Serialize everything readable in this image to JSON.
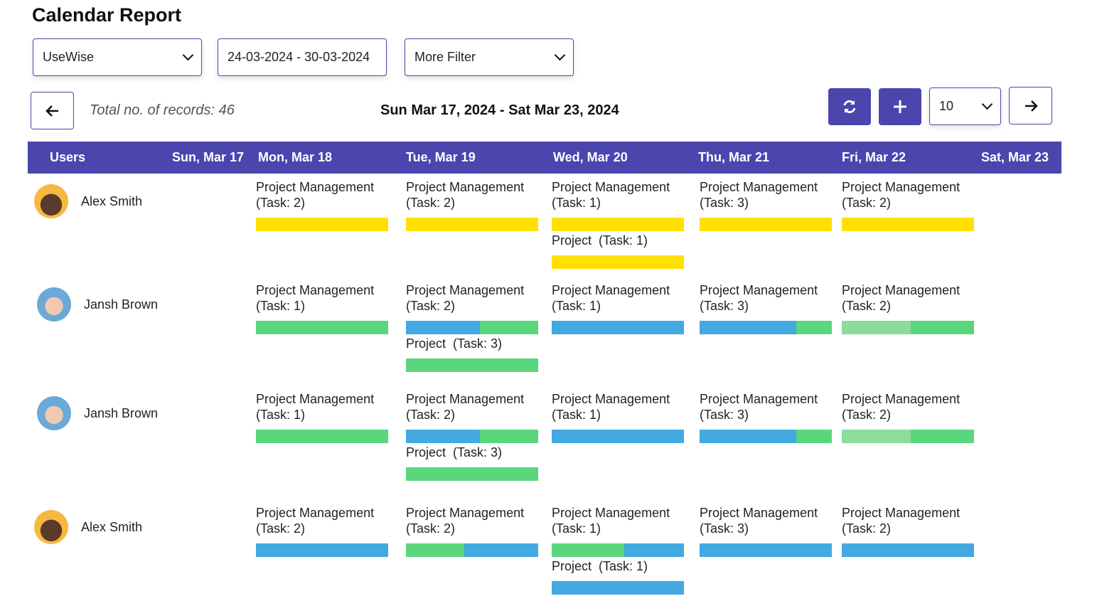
{
  "title": "Calendar Report",
  "filters": {
    "group_by": "UseWise",
    "date_range": "24-03-2024 - 30-03-2024",
    "more_filter": "More Filter"
  },
  "toolbar": {
    "total_records": "Total no. of records: 46",
    "week_range": "Sun Mar 17, 2024 - Sat Mar 23, 2024",
    "page_size": "10"
  },
  "icons": {
    "prev": "arrow-left-icon",
    "next": "arrow-right-icon",
    "refresh": "refresh-icon",
    "add": "plus-icon"
  },
  "colors": {
    "accent": "#4B45AE",
    "yellow": "#FFE000",
    "green": "#5AD67D",
    "blue": "#42A9E1",
    "lightgreen": "#8CDC9A"
  },
  "columns": [
    "Users",
    "Sun, Mar 17",
    "Mon, Mar 18",
    "Tue, Mar 19",
    "Wed, Mar 20",
    "Thu, Mar 21",
    "Fri, Mar 22",
    "Sat, Mar 23"
  ],
  "rows": [
    {
      "user": "Alex Smith",
      "avatar": "dark",
      "days": [
        [],
        [
          {
            "label": "Project Management\n(Task: 2)",
            "bar": [
              [
                "yellow",
                1
              ]
            ]
          }
        ],
        [
          {
            "label": "Project Management\n(Task: 2)",
            "bar": [
              [
                "yellow",
                1
              ]
            ]
          }
        ],
        [
          {
            "label": "Project Management\n(Task: 1)",
            "bar": [
              [
                "yellow",
                1
              ]
            ]
          },
          {
            "label": "Project  (Task: 1)",
            "bar": [
              [
                "yellow",
                1
              ]
            ]
          }
        ],
        [
          {
            "label": "Project Management\n(Task: 3)",
            "bar": [
              [
                "yellow",
                1
              ]
            ]
          }
        ],
        [
          {
            "label": "Project Management\n(Task: 2)",
            "bar": [
              [
                "yellow",
                1
              ]
            ]
          }
        ],
        []
      ]
    },
    {
      "user": "Jansh Brown",
      "avatar": "light",
      "days": [
        [],
        [
          {
            "label": "Project Management\n(Task: 1)",
            "bar": [
              [
                "green",
                1
              ]
            ]
          }
        ],
        [
          {
            "label": "Project Management\n(Task: 2)",
            "bar": [
              [
                "blue",
                0.56
              ],
              [
                "green",
                0.44
              ]
            ]
          },
          {
            "label": "Project  (Task: 3)",
            "bar": [
              [
                "green",
                1
              ]
            ]
          }
        ],
        [
          {
            "label": "Project Management\n(Task: 1)",
            "bar": [
              [
                "blue",
                1
              ]
            ]
          }
        ],
        [
          {
            "label": "Project Management\n(Task: 3)",
            "bar": [
              [
                "blue",
                0.73
              ],
              [
                "green",
                0.27
              ]
            ]
          }
        ],
        [
          {
            "label": "Project Management\n(Task: 2)",
            "bar": [
              [
                "lightgreen",
                0.52
              ],
              [
                "green",
                0.48
              ]
            ]
          }
        ],
        []
      ]
    },
    {
      "user": "Jansh Brown",
      "avatar": "light",
      "days": [
        [],
        [
          {
            "label": "Project Management\n(Task: 1)",
            "bar": [
              [
                "green",
                1
              ]
            ]
          }
        ],
        [
          {
            "label": "Project Management\n(Task: 2)",
            "bar": [
              [
                "blue",
                0.56
              ],
              [
                "green",
                0.44
              ]
            ]
          },
          {
            "label": "Project  (Task: 3)",
            "bar": [
              [
                "green",
                1
              ]
            ]
          }
        ],
        [
          {
            "label": "Project Management\n(Task: 1)",
            "bar": [
              [
                "blue",
                1
              ]
            ]
          }
        ],
        [
          {
            "label": "Project Management\n(Task: 3)",
            "bar": [
              [
                "blue",
                0.73
              ],
              [
                "green",
                0.27
              ]
            ]
          }
        ],
        [
          {
            "label": "Project Management\n(Task: 2)",
            "bar": [
              [
                "lightgreen",
                0.52
              ],
              [
                "green",
                0.48
              ]
            ]
          }
        ],
        []
      ]
    },
    {
      "user": "Alex Smith",
      "avatar": "dark",
      "days": [
        [],
        [
          {
            "label": "Project Management\n(Task: 2)",
            "bar": [
              [
                "blue",
                1
              ]
            ]
          }
        ],
        [
          {
            "label": "Project Management\n(Task: 2)",
            "bar": [
              [
                "green",
                0.44
              ],
              [
                "blue",
                0.56
              ]
            ]
          }
        ],
        [
          {
            "label": "Project Management\n(Task: 1)",
            "bar": [
              [
                "green",
                0.55
              ],
              [
                "blue",
                0.45
              ]
            ]
          },
          {
            "label": "Project  (Task: 1)",
            "bar": [
              [
                "blue",
                1
              ]
            ]
          }
        ],
        [
          {
            "label": "Project Management\n(Task: 3)",
            "bar": [
              [
                "blue",
                1
              ]
            ]
          }
        ],
        [
          {
            "label": "Project Management\n(Task: 2)",
            "bar": [
              [
                "blue",
                1
              ]
            ]
          }
        ],
        []
      ]
    }
  ]
}
